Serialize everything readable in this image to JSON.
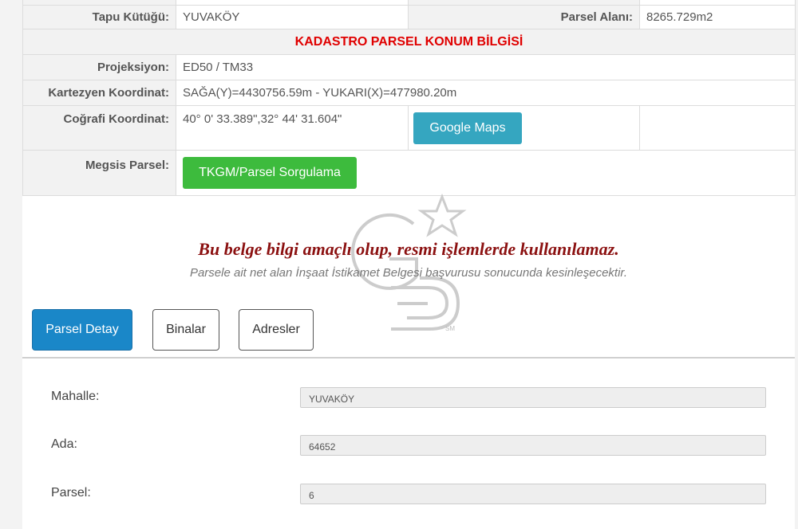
{
  "parcel_info": {
    "tapu_kutugu_label": "Tapu Kütüğü:",
    "tapu_kutugu_value": "YUVAKÖY",
    "parsel_alani_label": "Parsel Alanı:",
    "parsel_alani_value": "8265.729m2",
    "section_header": "KADASTRO PARSEL KONUM BİLGİSİ",
    "projeksiyon_label": "Projeksiyon:",
    "projeksiyon_value": "ED50 / TM33",
    "kartezyen_label": "Kartezyen Koordinat:",
    "kartezyen_value": "SAĞA(Y)=4430756.59m - YUKARI(X)=477980.20m",
    "cografi_label": "Coğrafi Koordinat:",
    "cografi_value": "40° 0' 33.389\",32° 44' 31.604\"",
    "google_maps_button": "Google Maps",
    "megsis_label": "Megsis Parsel:",
    "tkgm_button": "TKGM/Parsel Sorgulama"
  },
  "notice": {
    "main": "Bu belge bilgi amaçlı olup, resmi işlemlerde kullanılamaz.",
    "sub": "Parsele ait net alan İnşaat İstikamet Belgesi başvurusu sonucunda kesinleşecektir."
  },
  "tabs": [
    {
      "label": "Parsel Detay",
      "active": true
    },
    {
      "label": "Binalar",
      "active": false
    },
    {
      "label": "Adresler",
      "active": false
    }
  ],
  "details": {
    "mahalle_label": "Mahalle:",
    "mahalle_value": "YUVAKÖY",
    "ada_label": "Ada:",
    "ada_value": "64652",
    "parsel_label": "Parsel:",
    "parsel_value": "6"
  },
  "watermark": {
    "icon": "g3-star-logo-icon",
    "mark": "SM"
  },
  "colors": {
    "header_red": "#e00000",
    "notice_red": "#8b1010",
    "maps_button": "#35a6c0",
    "tkgm_button": "#3dbb3d",
    "active_tab": "#1a87c8"
  }
}
